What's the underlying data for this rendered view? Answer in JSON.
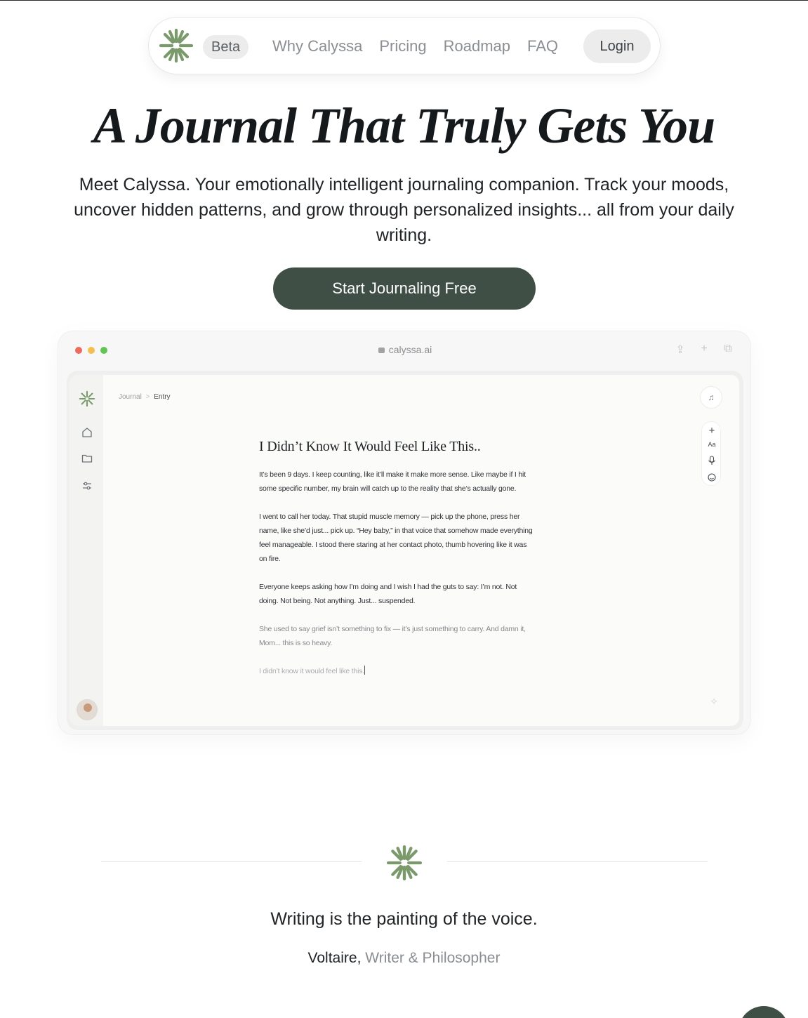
{
  "nav": {
    "badge": "Beta",
    "links": [
      "Why Calyssa",
      "Pricing",
      "Roadmap",
      "FAQ"
    ],
    "login": "Login"
  },
  "hero": {
    "headline": "A Journal That Truly Gets You",
    "subtext": "Meet Calyssa. Your emotionally intelligent journaling companion. Track your moods, uncover hidden patterns, and grow through personalized insights... all from your daily writing.",
    "cta": "Start Journaling Free"
  },
  "browser": {
    "url": "calyssa.ai"
  },
  "app": {
    "breadcrumb": {
      "root": "Journal",
      "separator": ">",
      "current": "Entry"
    },
    "tools": {
      "font_label": "Aa"
    },
    "entry": {
      "title": "I Didn’t Know It Would Feel Like This..",
      "paragraphs": [
        "It’s been 9 days. I keep counting, like it’ll make it make more sense. Like maybe if I hit some specific number, my brain will catch up to the reality that she’s actually gone.",
        "I went to call her today. That stupid muscle memory — pick up the phone, press her name, like she’d just... pick up. “Hey baby,” in that voice that somehow made everything feel manageable. I stood there staring at her contact photo, thumb hovering like it was on fire.",
        "Everyone keeps asking how I’m doing and I wish I had the guts to say: I’m not. Not doing. Not being. Not anything. Just... suspended.",
        "She used to say grief isn’t something to fix — it’s just something to carry. And damn it, Mom... this is so heavy.",
        "I didn’t know it would feel like this."
      ]
    }
  },
  "quote": {
    "text": "Writing is the painting of the voice.",
    "author": "Voltaire,",
    "role": "Writer & Philosopher"
  },
  "colors": {
    "brand_green": "#7a9a6c",
    "cta_dark": "#3f4f46"
  },
  "icons": [
    "calyssa-logo-icon",
    "lock-icon",
    "share-icon",
    "plus-icon",
    "copy-icon",
    "home-icon",
    "folder-icon",
    "sliders-icon",
    "music-note-icon",
    "microphone-icon",
    "emoji-icon",
    "sparkle-icon"
  ]
}
